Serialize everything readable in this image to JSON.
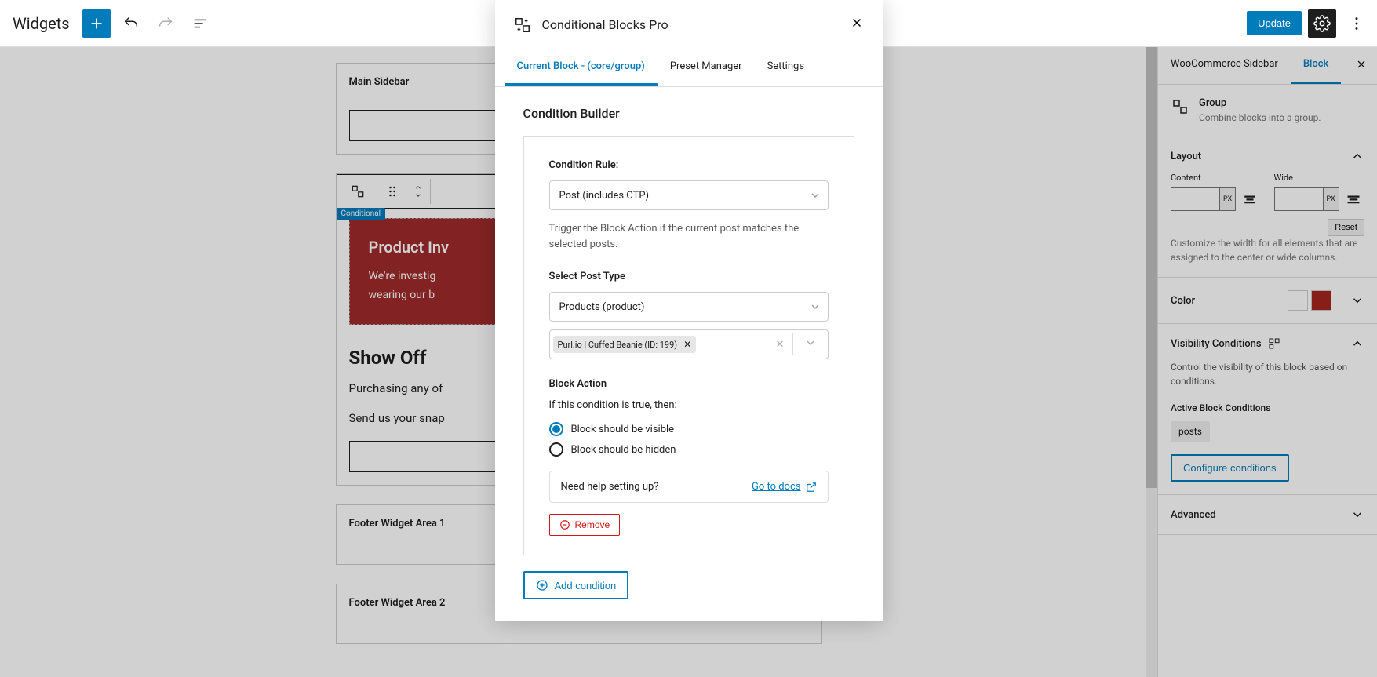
{
  "topbar": {
    "title": "Widgets",
    "update": "Update"
  },
  "canvas": {
    "area1_title": "Main Sidebar",
    "conditional_badge": "Conditional",
    "red_heading": "Product Inv",
    "red_line1": "We're investig",
    "red_line2": "wearing our b",
    "showoff_title": "Show Off",
    "showoff_p1": "Purchasing any of",
    "showoff_p2": "Send us your snap",
    "footer1": "Footer Widget Area 1",
    "footer2": "Footer Widget Area 2"
  },
  "sidebar": {
    "tab1": "WooCommerce Sidebar",
    "tab2": "Block",
    "block_name": "Group",
    "block_desc": "Combine blocks into a group.",
    "layout": {
      "title": "Layout",
      "content": "Content",
      "wide": "Wide",
      "px": "PX",
      "reset": "Reset",
      "help": "Customize the width for all elements that are assigned to the center or wide columns."
    },
    "color": {
      "title": "Color",
      "swatch2": "#a5251f"
    },
    "visibility": {
      "title": "Visibility Conditions",
      "desc": "Control the visibility of this block based on conditions.",
      "active_label": "Active Block Conditions",
      "pill": "posts",
      "configure": "Configure conditions"
    },
    "advanced": "Advanced"
  },
  "modal": {
    "title": "Conditional Blocks Pro",
    "tabs": {
      "current": "Current Block - (core/group)",
      "preset": "Preset Manager",
      "settings": "Settings"
    },
    "builder_title": "Condition Builder",
    "rule_label": "Condition Rule:",
    "rule_value": "Post (includes CTP)",
    "rule_desc": "Trigger the Block Action if the current post matches the selected posts.",
    "posttype_label": "Select Post Type",
    "posttype_value": "Products (product)",
    "tag_value": "Purl.io | Cuffed Beanie (ID: 199)",
    "action_label": "Block Action",
    "action_if": "If this condition is true, then:",
    "radio_visible": "Block should be visible",
    "radio_hidden": "Block should be hidden",
    "help_text": "Need help setting up?",
    "help_link": "Go to docs",
    "remove": "Remove",
    "add": "Add condition"
  }
}
